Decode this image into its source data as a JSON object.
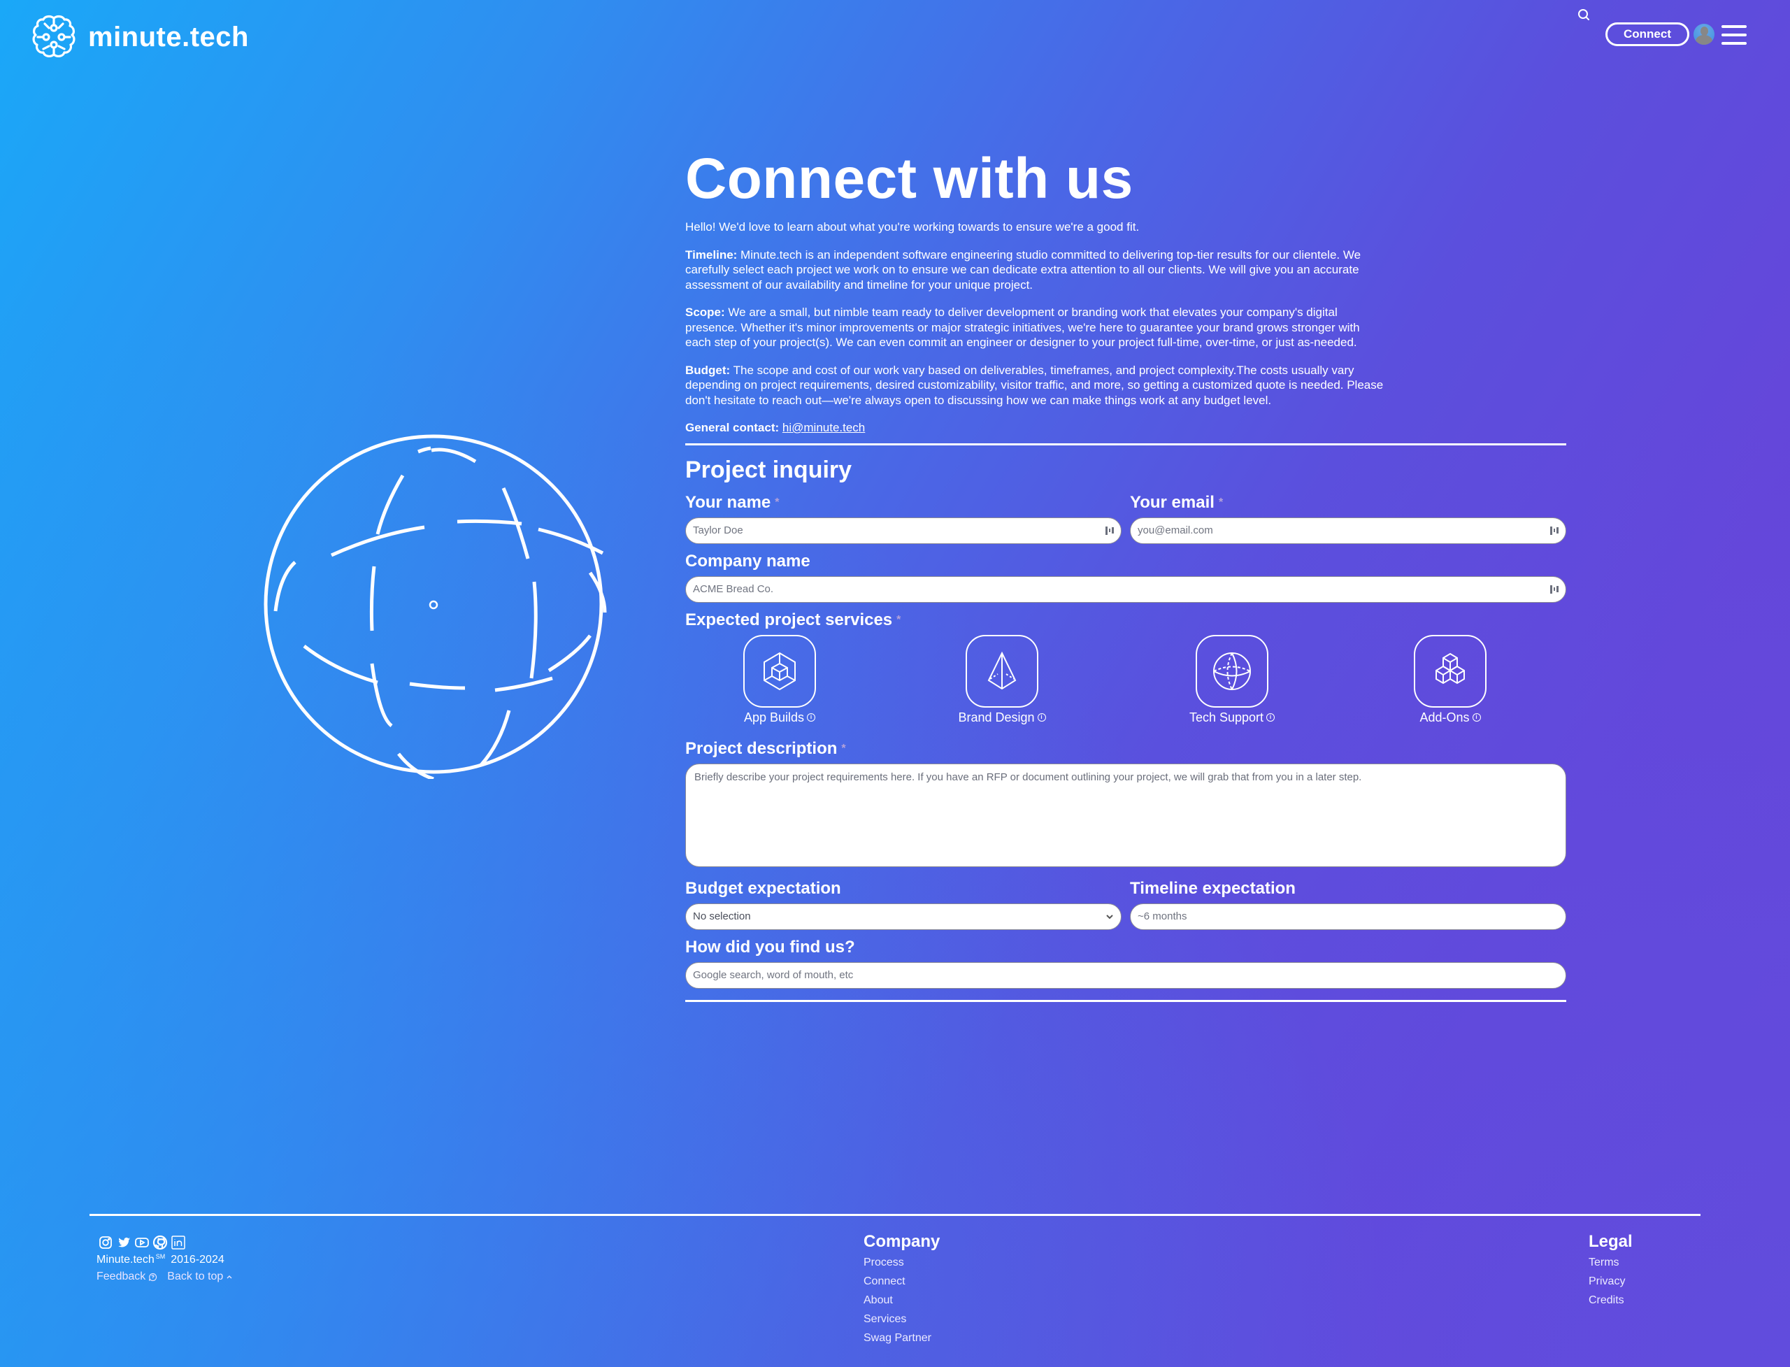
{
  "header": {
    "logo_text": "minute.tech",
    "connect_label": "Connect"
  },
  "main": {
    "title": "Connect with us",
    "intro": "Hello! We'd love to learn about what you're working towards to ensure we're a good fit.",
    "timeline_label": "Timeline:",
    "timeline_text": " Minute.tech is an independent software engineering studio committed to delivering top-tier results for our clientele. We carefully select each project we work on to ensure we can dedicate extra attention to all our clients. We will give you an accurate assessment of our availability and timeline for your unique project.",
    "scope_label": "Scope:",
    "scope_text": " We are a small, but nimble team ready to deliver development or branding work that elevates your company's digital presence. Whether it's minor improvements or major strategic initiatives, we're here to guarantee your brand grows stronger with each step of your project(s). We can even commit an engineer or designer to your project full-time, over-time, or just as-needed.",
    "budget_label": "Budget:",
    "budget_text": " The scope and cost of our work vary based on deliverables, timeframes, and project complexity.The costs usually vary depending on project requirements, desired customizability, visitor traffic, and more, so getting a customized quote is needed. Please don't hesitate to reach out—we're always open to discussing how we can make things work at any budget level.",
    "contact_label": "General contact:",
    "contact_email": "hi@minute.tech"
  },
  "form": {
    "title": "Project inquiry",
    "required_marker": "*",
    "name": {
      "label": "Your name",
      "placeholder": "Taylor Doe"
    },
    "email": {
      "label": "Your email",
      "placeholder": "you@email.com"
    },
    "company": {
      "label": "Company name",
      "placeholder": "ACME Bread Co."
    },
    "services": {
      "label": "Expected project services",
      "items": [
        {
          "label": "App Builds",
          "icon": "cube-in-hexagon-icon"
        },
        {
          "label": "Brand Design",
          "icon": "pyramid-icon"
        },
        {
          "label": "Tech Support",
          "icon": "globe-icon"
        },
        {
          "label": "Add-Ons",
          "icon": "stacked-cubes-icon"
        }
      ],
      "info_glyph": "i"
    },
    "description": {
      "label": "Project description",
      "placeholder": "Briefly describe your project requirements here. If you have an RFP or document outlining your project, we will grab that from you in a later step."
    },
    "budget": {
      "label": "Budget expectation",
      "selected": "No selection"
    },
    "timeline": {
      "label": "Timeline expectation",
      "placeholder": "~6 months"
    },
    "source": {
      "label": "How did you find us?",
      "placeholder": "Google search, word of mouth, etc"
    }
  },
  "footer": {
    "brand": "Minute.tech",
    "service_mark": "SM",
    "years": "2016-2024",
    "feedback": "Feedback",
    "back_to_top": "Back to top",
    "company": {
      "heading": "Company",
      "links": [
        "Process",
        "Connect",
        "About",
        "Services",
        "Swag Partner"
      ]
    },
    "legal": {
      "heading": "Legal",
      "links": [
        "Terms",
        "Privacy",
        "Credits"
      ]
    },
    "socials": [
      "instagram-icon",
      "twitter-icon",
      "youtube-icon",
      "github-icon",
      "linkedin-icon"
    ]
  }
}
